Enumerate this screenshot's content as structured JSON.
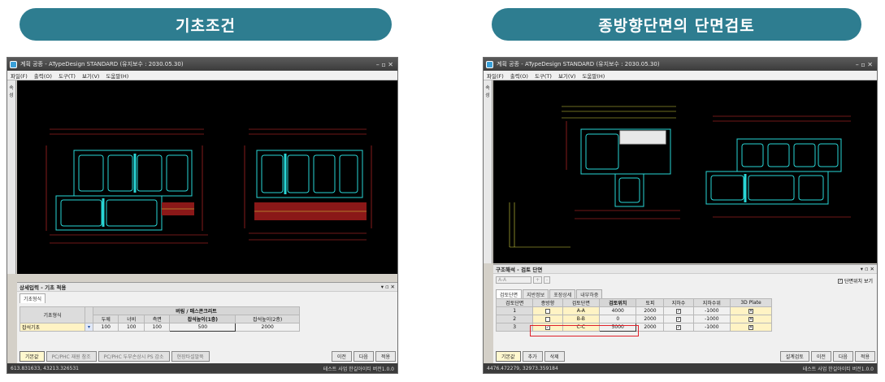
{
  "headers": {
    "left": "기초조건",
    "right": "종방향단면의 단면검토"
  },
  "app": {
    "title": "계획 공종 - ATypeDesign STANDARD",
    "license": "(유지보수 : 2030.05.30)",
    "win_controls": "–  ▫  ✕"
  },
  "menu": [
    "파일(F)",
    "출력(O)",
    "도구(T)",
    "보기(V)",
    "도움말(H)"
  ],
  "sidebar_label": "속성",
  "left": {
    "panel_title": "상세입력 - 기초 적용",
    "panel_ctl": "▾ ▫ ✕",
    "tab": "기초형식",
    "table": {
      "col_label": "기초형식",
      "group": "버림 / 매스콘크리트",
      "cols": [
        "두께",
        "너비",
        "측면",
        "잡석높이(1층)",
        "잡석높이(2층)"
      ],
      "row": {
        "type": "잡석기초",
        "values": [
          "100",
          "100",
          "100",
          "500",
          "2000"
        ]
      }
    },
    "buttons": [
      "기본값",
      "PC/PHC 재원 참조",
      "PC/PHC 두부손상시 PS 감소",
      "현장타설말뚝"
    ],
    "nav": [
      "이전",
      "다음",
      "적용"
    ],
    "status_left": "613.831633,  43213.326531",
    "status_right": "테스트 사업  한길아이티  버전1.0.0"
  },
  "right": {
    "panel_title": "구조해석 - 검토 단면",
    "panel_ctl": "▾ ▫ ✕",
    "combo": "A-A",
    "combo_btns": [
      "+",
      "-"
    ],
    "show_pos": "단면위치 보기",
    "tabs": [
      "검토단면",
      "지반정보",
      "포장상세",
      "내부하중"
    ],
    "cols": [
      "검토단면",
      "종방향",
      "검토단면",
      "검토위치",
      "토피",
      "지하수",
      "지하수위",
      "3D Plate"
    ],
    "rows": [
      {
        "no": "1",
        "section": "A-A",
        "pos": "4000",
        "cover": "2000",
        "gw_level": "-1000",
        "long": false
      },
      {
        "no": "2",
        "section": "B-B",
        "pos": "0",
        "cover": "2000",
        "gw_level": "-1000",
        "long": false
      },
      {
        "no": "3",
        "section": "C-C",
        "pos": "5000",
        "cover": "2000",
        "gw_level": "-1000",
        "long": true
      }
    ],
    "buttons": [
      "기본값",
      "추가",
      "삭제"
    ],
    "nav": [
      "설계검토",
      "이전",
      "다음",
      "적용"
    ],
    "status_left": "4476.472279,  32973.359184",
    "status_right": "테스트 사업  한길아이티  버전1.0.0"
  },
  "colors": {
    "accent": "#2e7d90",
    "cad_line": "#29d6d6",
    "cad_dim": "#e03030",
    "cad_text": "#d8d840"
  }
}
